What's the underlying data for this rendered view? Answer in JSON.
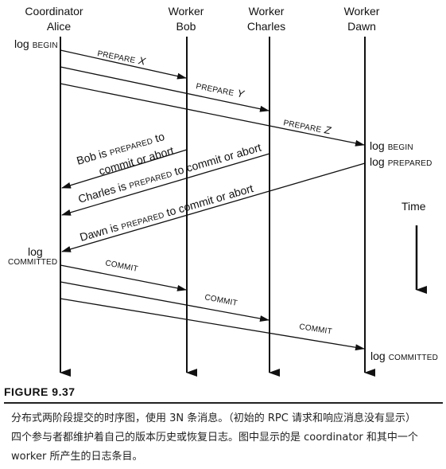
{
  "participants": {
    "coordinator": {
      "role": "Coordinator",
      "name": "Alice"
    },
    "bob": {
      "role": "Worker",
      "name": "Bob"
    },
    "charles": {
      "role": "Worker",
      "name": "Charles"
    },
    "dawn": {
      "role": "Worker",
      "name": "Dawn"
    }
  },
  "log_entries": {
    "alice_begin": {
      "prefix": "log",
      "tag": "BEGIN"
    },
    "alice_committed": {
      "prefix": "log",
      "tag": "COMMITTED"
    },
    "dawn_begin": {
      "prefix": "log",
      "tag": "BEGIN"
    },
    "dawn_prepared": {
      "prefix": "log",
      "tag": "PREPARED"
    },
    "dawn_committed": {
      "prefix": "log",
      "tag": "COMMITTED"
    }
  },
  "messages": {
    "prepare_x": {
      "label": "PREPARE",
      "arg": "X"
    },
    "prepare_y": {
      "label": "PREPARE",
      "arg": "Y"
    },
    "prepare_z": {
      "label": "PREPARE",
      "arg": "Z"
    },
    "bob_prepared": {
      "line1_a": "Bob is ",
      "line1_sc": "PREPARED",
      "line1_b": " to",
      "line2": "commit or abort"
    },
    "charles_prepared": {
      "a": "Charles is ",
      "sc": "PREPARED",
      "b": " to commit or abort"
    },
    "dawn_prepared": {
      "a": "Dawn is ",
      "sc": "PREPARED",
      "b": " to commit or abort"
    },
    "commit_bob": "COMMIT",
    "commit_charles": "COMMIT",
    "commit_dawn": "COMMIT"
  },
  "time_label": "Time",
  "figure": {
    "title": "FIGURE 9.37",
    "caption_lines": [
      "分布式两阶段提交的时序图，使用 3N 条消息。（初始的 RPC 请求和响应消息没有显示）",
      "四个参与者都维护着自己的版本历史或恢复日志。图中显示的是 coordinator 和其中一个",
      "worker 所产生的日志条目。"
    ]
  }
}
